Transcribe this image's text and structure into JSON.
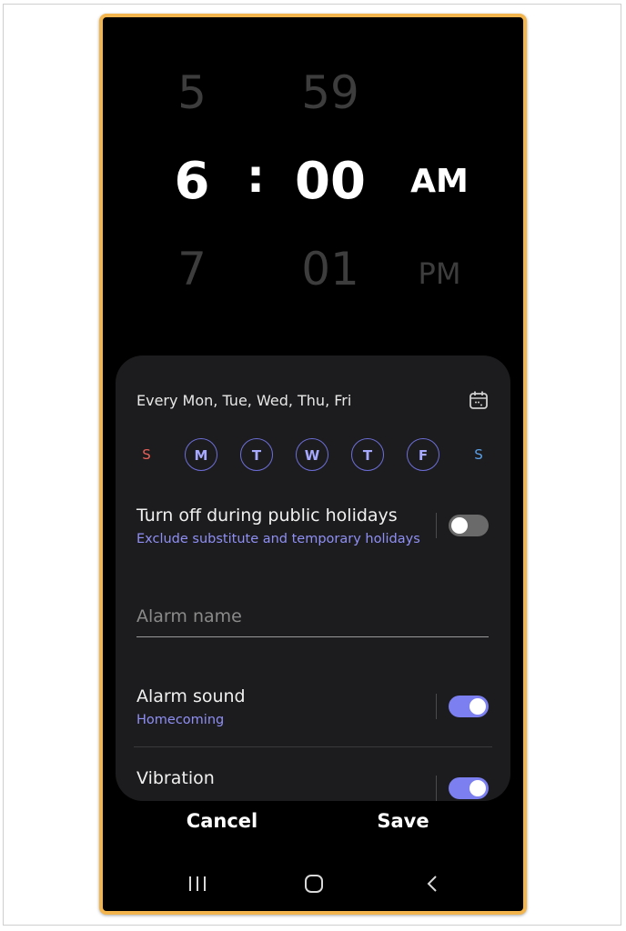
{
  "time_picker": {
    "hour_prev": "5",
    "hour_current": "6",
    "hour_next": "7",
    "separator": ":",
    "minute_prev": "59",
    "minute_current": "00",
    "minute_next": "01",
    "ampm_current": "AM",
    "ampm_next": "PM"
  },
  "repeat": {
    "summary": "Every Mon, Tue, Wed, Thu, Fri",
    "days": [
      {
        "label": "S",
        "selected": false,
        "color": "#e7615a"
      },
      {
        "label": "M",
        "selected": true
      },
      {
        "label": "T",
        "selected": true
      },
      {
        "label": "W",
        "selected": true
      },
      {
        "label": "T",
        "selected": true
      },
      {
        "label": "F",
        "selected": true
      },
      {
        "label": "S",
        "selected": false,
        "color": "#5b9fe6"
      }
    ]
  },
  "holidays": {
    "title": "Turn off during public holidays",
    "subtitle": "Exclude substitute and temporary holidays",
    "enabled": false
  },
  "alarm_name": {
    "placeholder": "Alarm name",
    "value": ""
  },
  "alarm_sound": {
    "title": "Alarm sound",
    "subtitle": "Homecoming",
    "enabled": true
  },
  "vibration": {
    "title": "Vibration",
    "enabled": true
  },
  "actions": {
    "cancel_label": "Cancel",
    "save_label": "Save"
  },
  "nav": {
    "recents_icon": "recent-apps-icon",
    "home_icon": "home-icon",
    "back_icon": "back-icon"
  },
  "colors": {
    "accent": "#7b7ff0",
    "frame": "#f3b54d",
    "card_bg": "#1c1c1e"
  }
}
